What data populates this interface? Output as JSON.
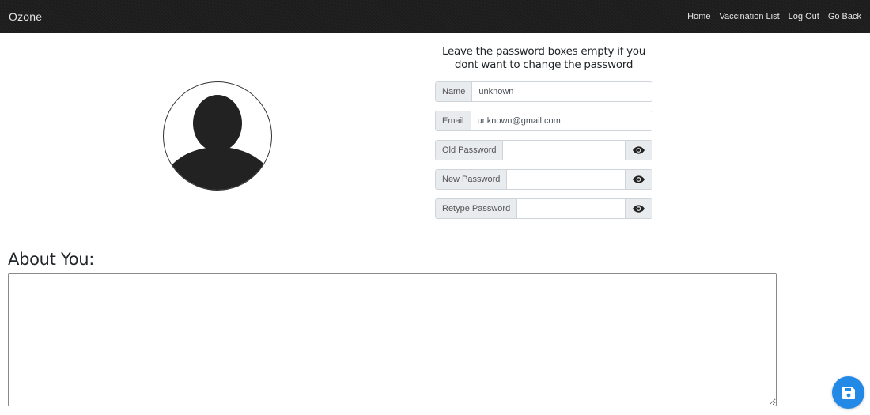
{
  "navbar": {
    "brand": "Ozone",
    "links": [
      "Home",
      "Vaccination List",
      "Log Out",
      "Go Back"
    ]
  },
  "profile": {
    "icon": "user-avatar-icon"
  },
  "form": {
    "note": "Leave the password boxes empty if you dont want to change the password",
    "name": {
      "label": "Name",
      "value": "unknown"
    },
    "email": {
      "label": "Email",
      "value": "unknown@gmail.com"
    },
    "old_password": {
      "label": "Old Password",
      "value": "",
      "icon": "eye-icon"
    },
    "new_password": {
      "label": "New Password",
      "value": "",
      "icon": "eye-icon"
    },
    "retype_password": {
      "label": "Retype Password",
      "value": "",
      "icon": "eye-icon"
    }
  },
  "about": {
    "heading": "About You:",
    "value": ""
  },
  "save": {
    "icon": "floppy-disk-icon"
  },
  "colors": {
    "navbar_bg": "#1c1c1c",
    "accent": "#2389e6",
    "addon_bg": "#e9ecef",
    "border": "#ced4da"
  }
}
